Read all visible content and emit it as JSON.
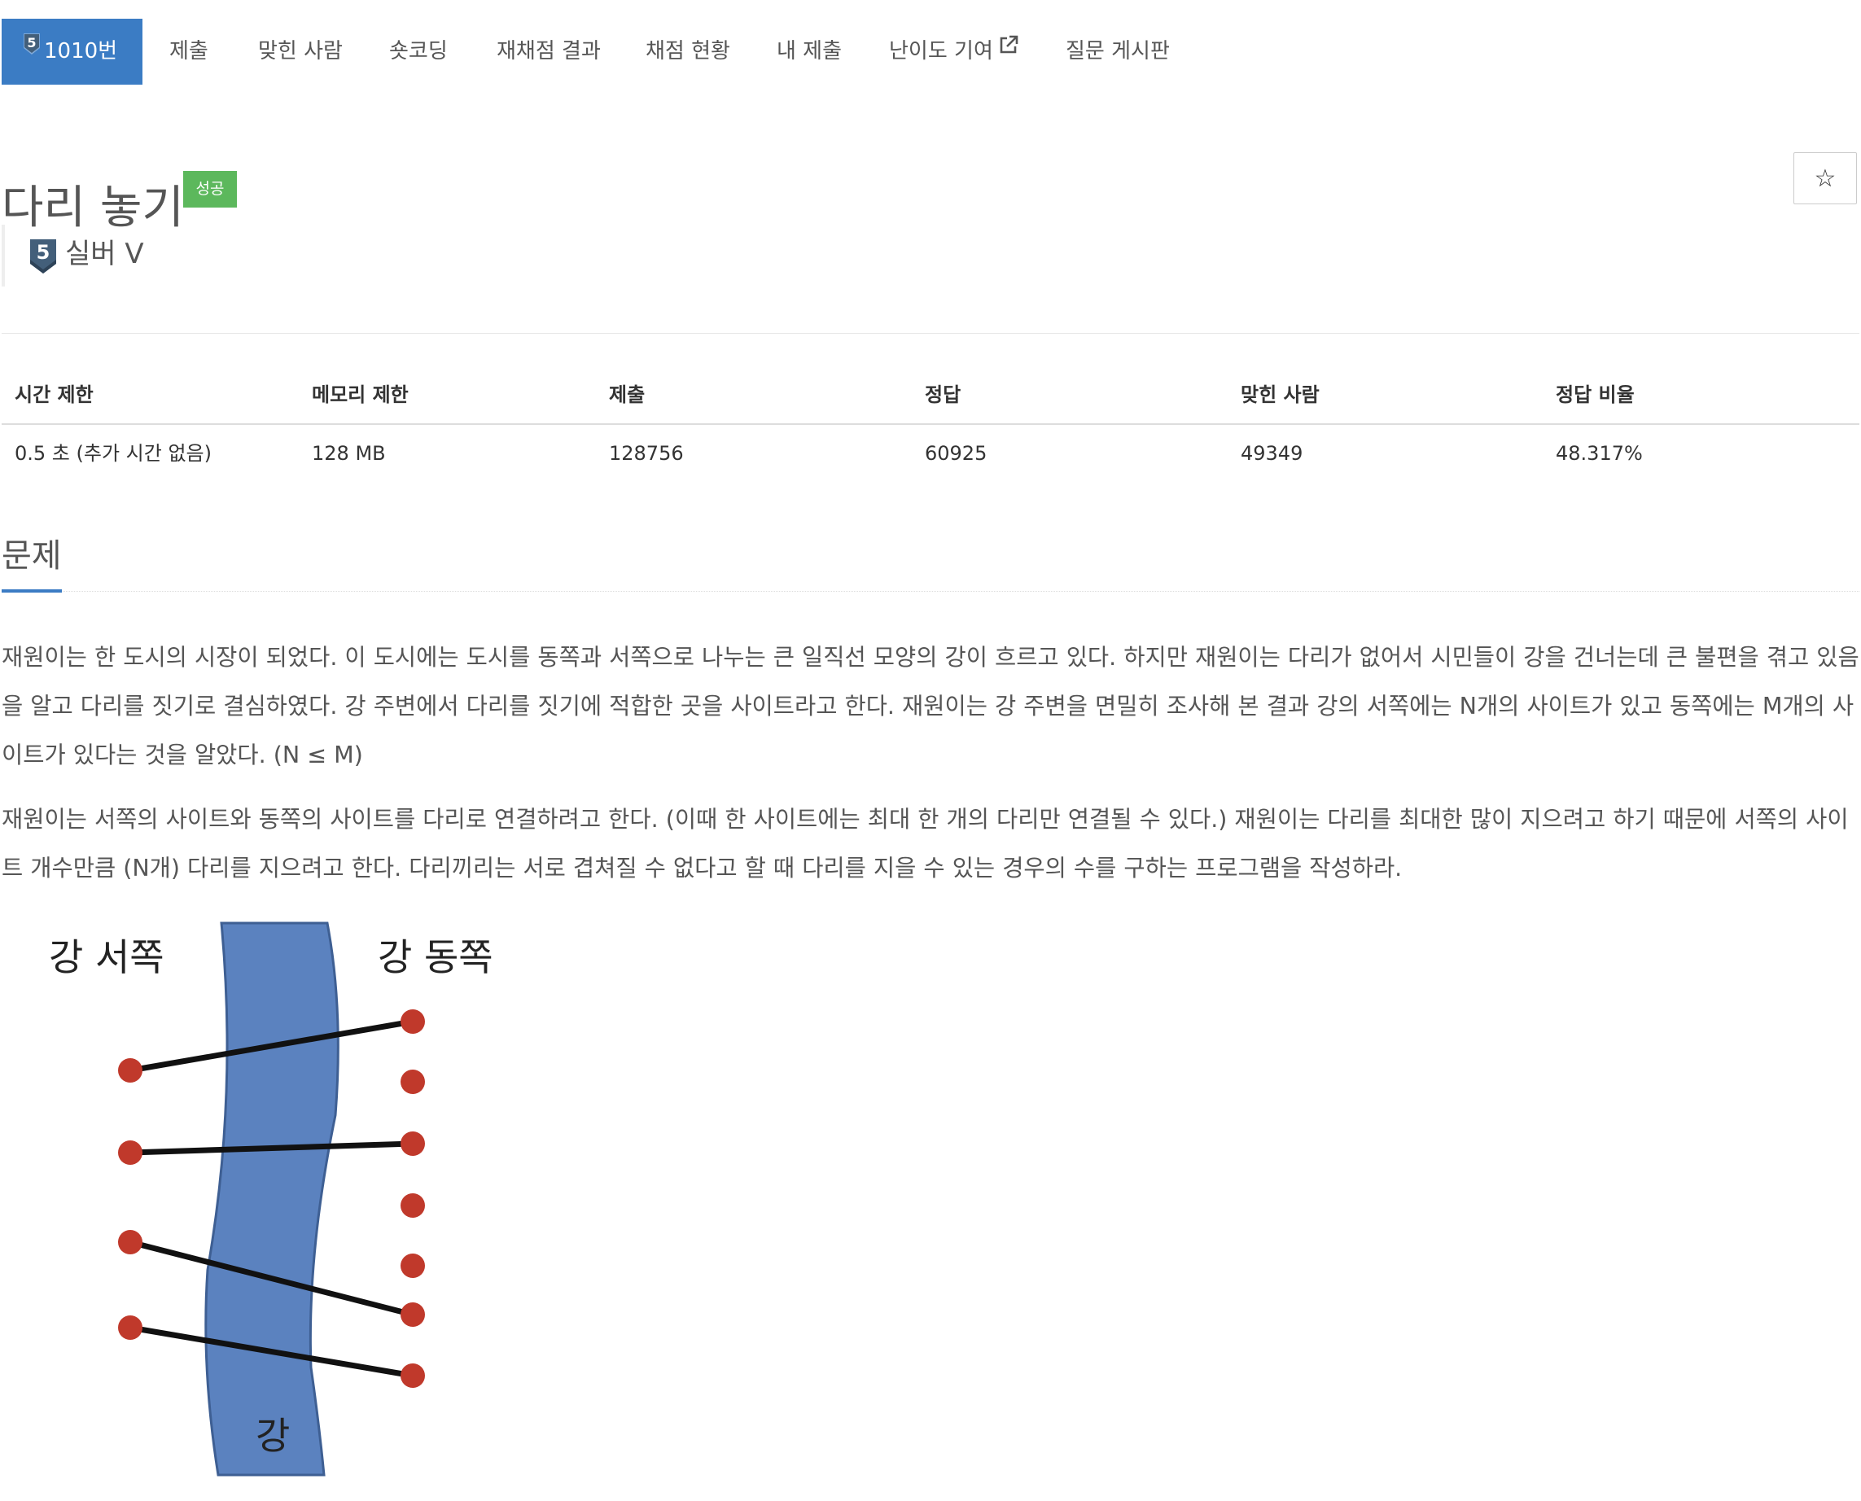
{
  "nav": {
    "tier_number": "5",
    "items": [
      {
        "label": "1010번"
      },
      {
        "label": "제출"
      },
      {
        "label": "맞힌 사람"
      },
      {
        "label": "숏코딩"
      },
      {
        "label": "재채점 결과"
      },
      {
        "label": "채점 현황"
      },
      {
        "label": "내 제출"
      },
      {
        "label": "난이도 기여"
      },
      {
        "label": "질문 게시판"
      }
    ]
  },
  "problem": {
    "title": "다리 놓기",
    "status_badge": "성공",
    "star_symbol": "☆",
    "tier_number": "5",
    "tier_label": "실버 V",
    "tier_color": "#435f7a",
    "accent_color": "#3b7cc4",
    "badge_color": "#5cb85c"
  },
  "stats": {
    "headers": [
      "시간 제한",
      "메모리 제한",
      "제출",
      "정답",
      "맞힌 사람",
      "정답 비율"
    ],
    "values": [
      "0.5 초 (추가 시간 없음)",
      "128 MB",
      "128756",
      "60925",
      "49349",
      "48.317%"
    ]
  },
  "section": {
    "title": "문제",
    "paragraphs": [
      "재원이는 한 도시의 시장이 되었다. 이 도시에는 도시를 동쪽과 서쪽으로 나누는 큰 일직선 모양의 강이 흐르고 있다. 하지만 재원이는 다리가 없어서 시민들이 강을 건너는데 큰 불편을 겪고 있음을 알고 다리를 짓기로 결심하였다. 강 주변에서 다리를 짓기에 적합한 곳을 사이트라고 한다. 재원이는 강 주변을 면밀히 조사해 본 결과 강의 서쪽에는 N개의 사이트가 있고 동쪽에는 M개의 사이트가 있다는 것을 알았다. (N ≤ M)",
      "재원이는 서쪽의 사이트와 동쪽의 사이트를 다리로 연결하려고 한다. (이때 한 사이트에는 최대 한 개의 다리만 연결될 수 있다.) 재원이는 다리를 최대한 많이 지으려고 하기 때문에 서쪽의 사이트 개수만큼 (N개) 다리를 지으려고 한다. 다리끼리는 서로 겹쳐질 수 없다고 할 때 다리를 지을 수 있는 경우의 수를 구하는 프로그램을 작성하라."
    ]
  },
  "figure": {
    "west_label": "강 서쪽",
    "east_label": "강 동쪽",
    "river_label": "강",
    "river_color": "#5b82bf",
    "site_color": "#c0392b",
    "bridge_color": "#111111"
  }
}
